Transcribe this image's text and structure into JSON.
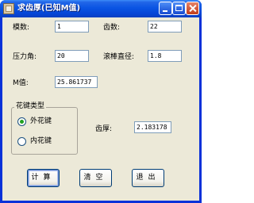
{
  "window": {
    "title": "求齿厚(已知M值)"
  },
  "form": {
    "module_label": "模数:",
    "module_value": "1",
    "teeth_label": "齿数:",
    "teeth_value": "22",
    "pressure_angle_label": "压力角:",
    "pressure_angle_value": "20",
    "roller_diameter_label": "滚棒直径:",
    "roller_diameter_value": "1.8",
    "m_value_label": "M值:",
    "m_value_value": "25.861737",
    "tooth_thickness_label": "齿厚:",
    "tooth_thickness_value": "2.183178"
  },
  "spline_type": {
    "group_label": "花键类型",
    "options": [
      {
        "label": "外花键",
        "checked": true
      },
      {
        "label": "内花键",
        "checked": false
      }
    ]
  },
  "buttons": {
    "calculate": "计算",
    "clear": "清空",
    "exit": "退出"
  }
}
